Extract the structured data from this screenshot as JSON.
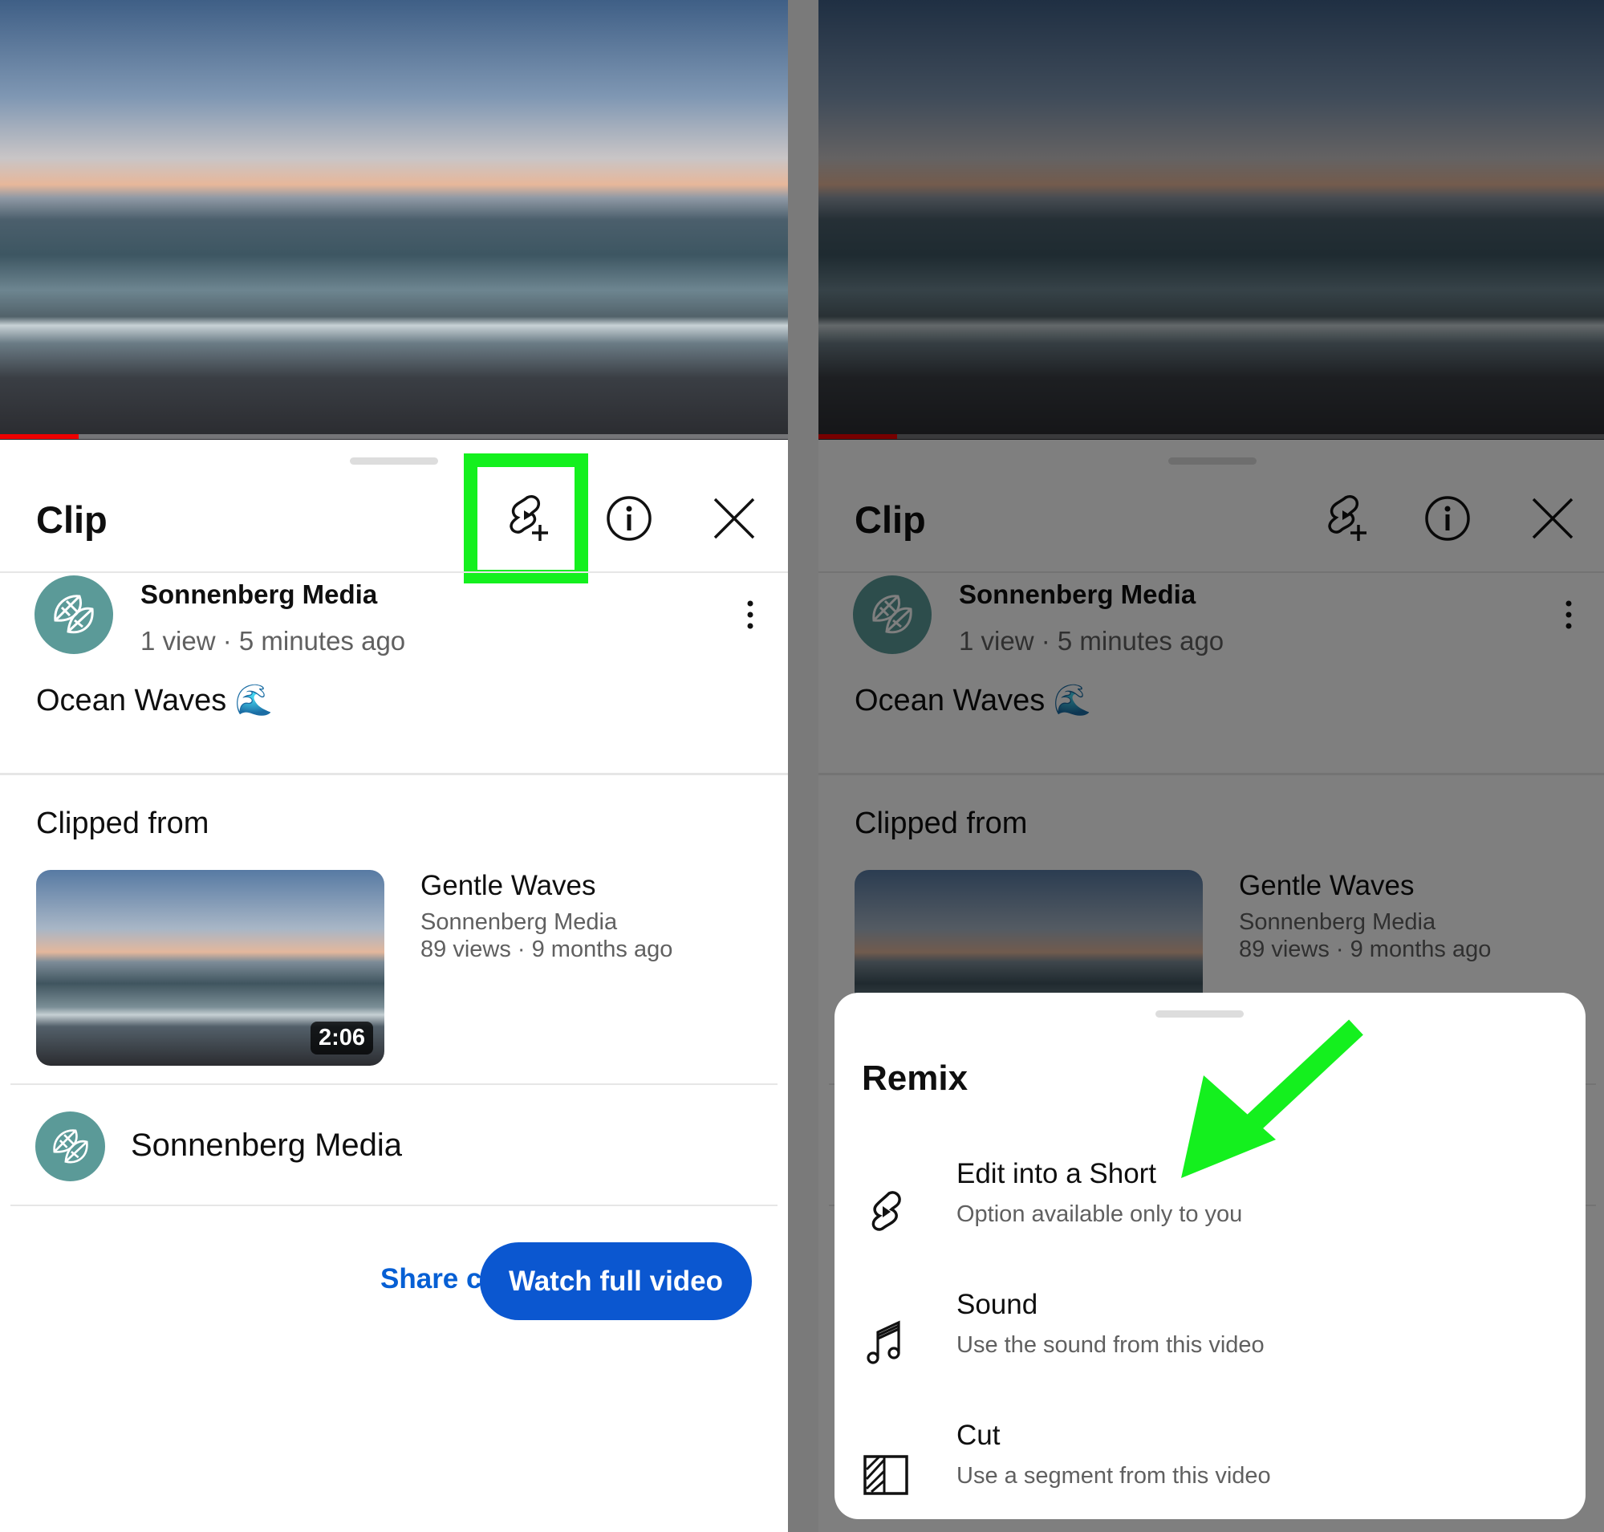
{
  "clip_sheet": {
    "title": "Clip",
    "channel_name": "Sonnenberg Media",
    "meta": "1 view · 5 minutes ago",
    "clip_title": "Ocean Waves 🌊",
    "clipped_from_label": "Clipped from",
    "source_video": {
      "title": "Gentle Waves",
      "channel": "Sonnenberg Media",
      "meta": "89 views · 9 months ago",
      "duration": "2:06"
    },
    "channel_row_name": "Sonnenberg Media",
    "share_label": "Share clip",
    "watch_label": "Watch full video",
    "icons": [
      "remix-icon",
      "info-icon",
      "close-icon",
      "more-vert-icon"
    ]
  },
  "remix_sheet": {
    "title": "Remix",
    "items": [
      {
        "icon": "shorts-icon",
        "label": "Edit into a Short",
        "sub": "Option available only to you"
      },
      {
        "icon": "music-note-icon",
        "label": "Sound",
        "sub": "Use the sound from this video"
      },
      {
        "icon": "cut-icon",
        "label": "Cut",
        "sub": "Use a segment from this video"
      }
    ]
  },
  "colors": {
    "highlight": "#14f01e",
    "accent_blue": "#0b57d0",
    "link_blue": "#065fd4",
    "progress_red": "#ee0000"
  },
  "video_progress_fraction": 0.1
}
